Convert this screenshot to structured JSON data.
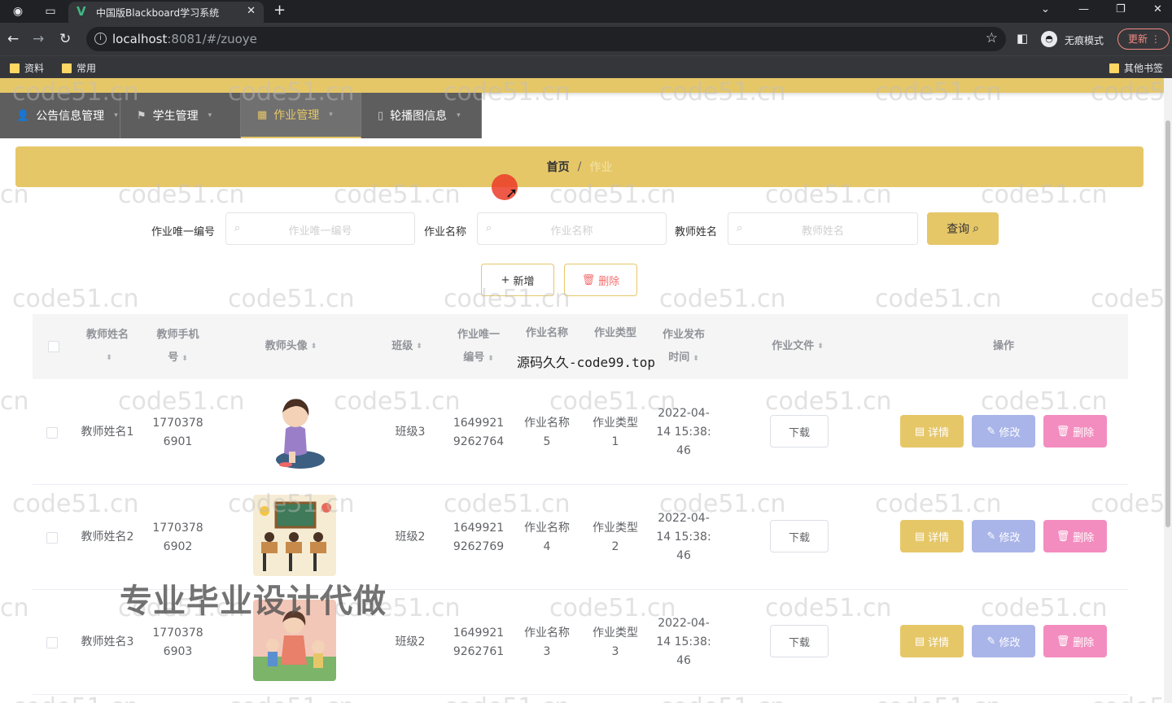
{
  "browser": {
    "tab_title": "中国版Blackboard学习系统",
    "url_host": "localhost",
    "url_rest": ":8081/#/zuoye",
    "incognito_label": "无痕模式",
    "update_label": "更新",
    "bookmarks": [
      "资料",
      "常用"
    ],
    "other_bookmarks": "其他书签"
  },
  "menu": {
    "items": [
      {
        "label": "公告信息管理",
        "icon": "user-icon"
      },
      {
        "label": "学生管理",
        "icon": "flag-icon"
      },
      {
        "label": "作业管理",
        "icon": "chart-icon"
      },
      {
        "label": "轮播图信息",
        "icon": "phone-icon"
      }
    ],
    "active_index": 2
  },
  "breadcrumb": {
    "home": "首页",
    "separator": "/",
    "current": "作业"
  },
  "search": {
    "fields": [
      {
        "label": "作业唯一编号",
        "placeholder": "作业唯一编号"
      },
      {
        "label": "作业名称",
        "placeholder": "作业名称"
      },
      {
        "label": "教师姓名",
        "placeholder": "教师姓名"
      }
    ],
    "query_label": "查询"
  },
  "actions": {
    "add_label": "新增",
    "delete_label": "删除"
  },
  "table": {
    "headers": {
      "teacher_name": "教师姓名",
      "teacher_phone_a": "教师手机",
      "teacher_phone_b": "号",
      "teacher_avatar": "教师头像",
      "class": "班级",
      "hw_id_a": "作业唯一",
      "hw_id_b": "编号",
      "hw_name": "作业名称",
      "hw_type": "作业类型",
      "hw_time_a": "作业发布",
      "hw_time_b": "时间",
      "hw_file": "作业文件",
      "ops": "操作"
    },
    "rows": [
      {
        "teacher_name": "教师姓名1",
        "phone_a": "1770378",
        "phone_b": "6901",
        "avatar": "girl-sitting-illustration",
        "class": "班级3",
        "id_a": "1649921",
        "id_b": "9262764",
        "name_a": "作业名称",
        "name_b": "5",
        "type_a": "作业类型",
        "type_b": "1",
        "time_a": "2022-04-",
        "time_b": "14 15:38:",
        "time_c": "46",
        "download": "下载",
        "detail": "详情",
        "edit": "修改",
        "del": "删除"
      },
      {
        "teacher_name": "教师姓名2",
        "phone_a": "1770378",
        "phone_b": "6902",
        "avatar": "classroom-illustration",
        "class": "班级2",
        "id_a": "1649921",
        "id_b": "9262769",
        "name_a": "作业名称",
        "name_b": "4",
        "type_a": "作业类型",
        "type_b": "2",
        "time_a": "2022-04-",
        "time_b": "14 15:38:",
        "time_c": "46",
        "download": "下载",
        "detail": "详情",
        "edit": "修改",
        "del": "删除"
      },
      {
        "teacher_name": "教师姓名3",
        "phone_a": "1770378",
        "phone_b": "6903",
        "avatar": "family-illustration",
        "class": "班级2",
        "id_a": "1649921",
        "id_b": "9262761",
        "name_a": "作业名称",
        "name_b": "3",
        "type_a": "作业类型",
        "type_b": "3",
        "time_a": "2022-04-",
        "time_b": "14 15:38:",
        "time_c": "46",
        "download": "下载",
        "detail": "详情",
        "edit": "修改",
        "del": "删除"
      }
    ]
  },
  "overlays": {
    "watermark": "code51.cn",
    "code_banner": "源码久久-code99.top",
    "ad_banner": "专业毕业设计代做"
  },
  "colors": {
    "accent": "#e6c768",
    "edit": "#a9b4e8",
    "delete": "#f38dbf",
    "menu_bg": "#5e5e5e"
  }
}
